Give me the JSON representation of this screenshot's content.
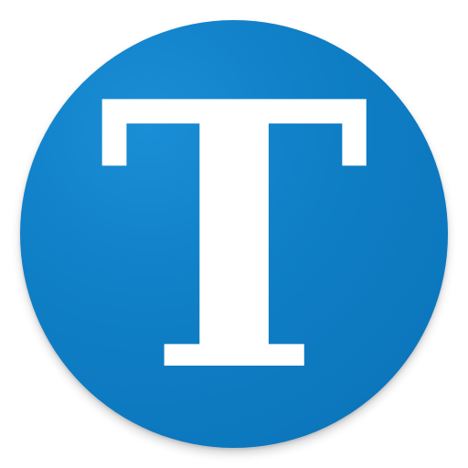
{
  "icon": {
    "letter": "T",
    "background_color": "#0f7fc6",
    "letter_color": "#ffffff",
    "shape": "circle"
  }
}
